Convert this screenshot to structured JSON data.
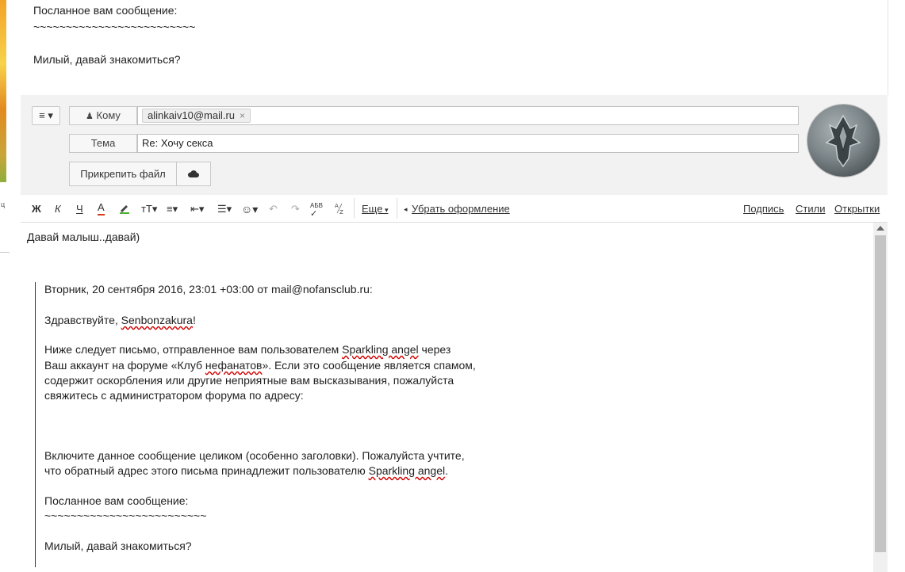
{
  "quote_top": {
    "lines": [
      "Посланное вам сообщение:",
      "~~~~~~~~~~~~~~~~~~~~~~~~~",
      "Милый, давай знакомиться?"
    ]
  },
  "compose": {
    "menu_label": "≡ ▾",
    "to_label": "Кому",
    "to_recipient": "alinkaiv10@mail.ru",
    "chip_remove": "×",
    "subject_label": "Тема",
    "subject_value": "Re: Хочу секса",
    "attach_label": "Прикрепить файл"
  },
  "toolbar": {
    "bold": "Ж",
    "italic": "К",
    "underline": "Ч",
    "color": "A",
    "font_size": "тТ▾",
    "align": "≡▾",
    "indent": "⇤▾",
    "list": "☰▾",
    "emoji": "☺▾",
    "spell": "АБВ",
    "more": "Еще",
    "clear_format": "Убрать оформление",
    "signature": "Подпись",
    "styles": "Стили",
    "postcards": "Открытки"
  },
  "editor": {
    "reply": "Давай малыш..давай)",
    "header": "Вторник, 20 сентября 2016, 23:01 +03:00 от mail@nofansclub.ru:",
    "greeting_pre": "Здравствуйте, ",
    "greeting_name": "Senbonzakura",
    "greeting_post": "!",
    "p1_l1_pre": "Ниже следует письмо, отправленное вам пользователем ",
    "p1_l1_user": "Sparkling angel",
    "p1_l1_post": " через",
    "p1_l2_pre": "Ваш аккаунт на форуме «Клуб ",
    "p1_l2_word": "нефанатов",
    "p1_l2_post": "». Если это сообщение является спамом,",
    "p1_l3": "содержит оскорбления или другие неприятные вам высказывания, пожалуйста",
    "p1_l4": "свяжитесь с администратором форума по адресу:",
    "p2_l1": "Включите данное сообщение целиком (особенно заголовки). Пожалуйста учтите,",
    "p2_l2_pre": "что обратный адрес этого письма принадлежит пользователю ",
    "p2_l2_user": "Sparkling angel",
    "p2_l2_post": ".",
    "p3_l1": "Посланное вам сообщение:",
    "p3_l2": "~~~~~~~~~~~~~~~~~~~~~~~~~",
    "p3_l3": "Милый, давай знакомиться?"
  },
  "colors": {
    "accent_red": "#d00000",
    "quote_bar": "#1a3a5c"
  },
  "icons": [
    "user-icon",
    "cloud-icon",
    "undo-icon",
    "redo-icon",
    "clear-format-icon",
    "emoji-icon"
  ]
}
